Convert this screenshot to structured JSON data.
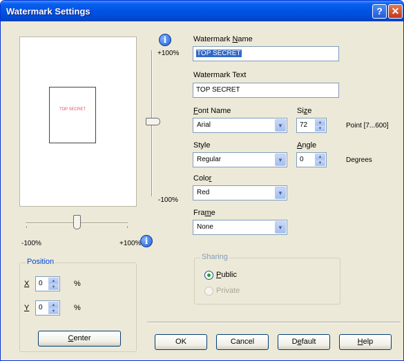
{
  "window": {
    "title": "Watermark Settings",
    "help_glyph": "?",
    "close_glyph": "✕"
  },
  "preview": {
    "watermark_text": "TOP SECRET"
  },
  "h_slider": {
    "min_label": "-100%",
    "max_label": "+100%"
  },
  "v_slider": {
    "max_label": "+100%",
    "min_label": "-100%"
  },
  "icons": {
    "info_glyph": "i"
  },
  "fields": {
    "name": {
      "label_pre": "Watermark ",
      "label_key": "N",
      "label_post": "ame",
      "value": "TOP SECRET"
    },
    "text": {
      "label": "Watermark Text",
      "value": "TOP SECRET"
    },
    "font": {
      "label_key": "F",
      "label_post": "ont Name",
      "value": "Arial"
    },
    "size": {
      "label_pre": "Si",
      "label_key": "z",
      "label_post": "e",
      "value": "72",
      "unit": "Point [7...600]"
    },
    "style": {
      "label": "Style",
      "value": "Regular"
    },
    "angle": {
      "label_key": "A",
      "label_post": "ngle",
      "value": "0",
      "unit": "Degrees"
    },
    "color": {
      "label_pre": "Colo",
      "label_key": "r",
      "value": "Red"
    },
    "frame": {
      "label_pre": "Fra",
      "label_key": "m",
      "label_post": "e",
      "value": "None"
    }
  },
  "position": {
    "title": "Position",
    "x_label": "X",
    "x_value": "0",
    "x_unit": "%",
    "y_label": "Y",
    "y_value": "0",
    "y_unit": "%",
    "center_label_key": "C",
    "center_label_post": "enter"
  },
  "sharing": {
    "title": "Sharing",
    "public_key": "P",
    "public_post": "ublic",
    "private_label": "Private",
    "selected": "public"
  },
  "buttons": {
    "ok": "OK",
    "cancel": "Cancel",
    "default_pre": "D",
    "default_key": "e",
    "default_post": "fault",
    "help_key": "H",
    "help_post": "elp"
  },
  "glyphs": {
    "dropdown": "▼",
    "spin_up": "▲",
    "spin_down": "▼"
  }
}
